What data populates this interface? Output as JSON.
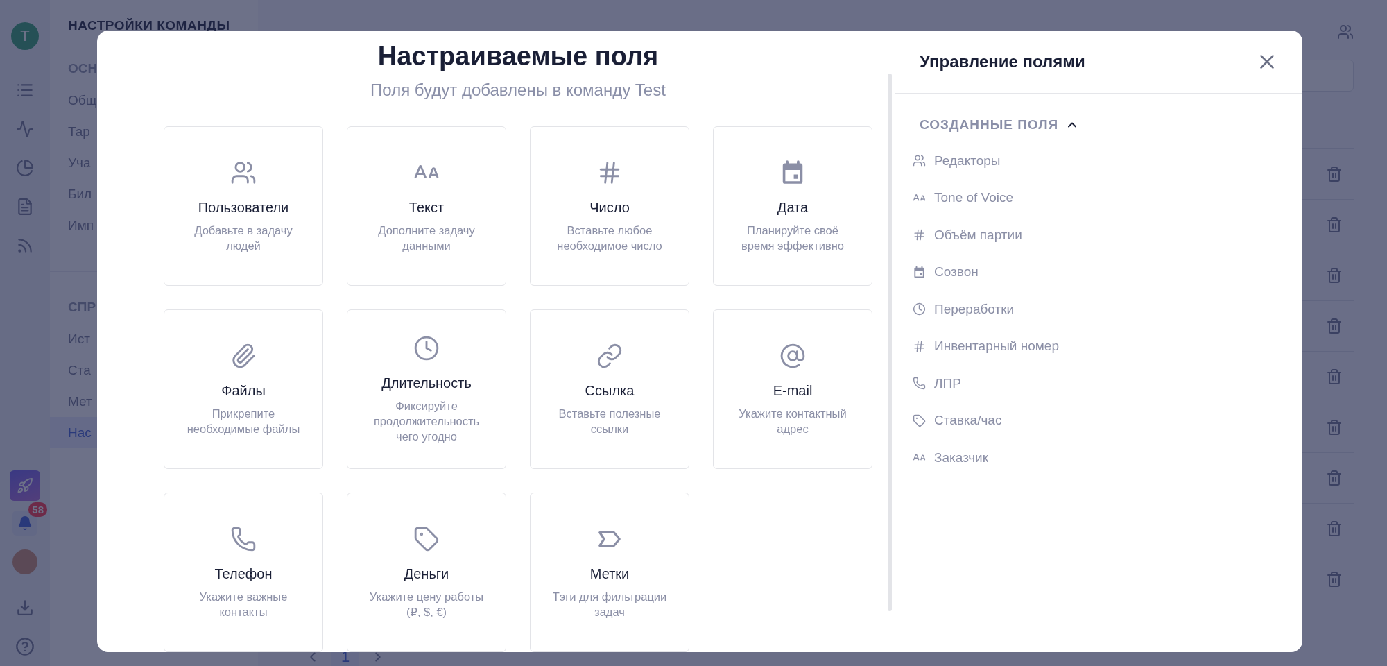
{
  "rail": {
    "team_initial": "T",
    "notifications_badge": "58"
  },
  "settings_nav": {
    "title": "НАСТРОЙКИ КОМАНДЫ",
    "sections": [
      {
        "label": "ОСН",
        "items": [
          {
            "label": "Общ",
            "selected": false
          },
          {
            "label": "Тар",
            "selected": false
          },
          {
            "label": "Уча",
            "selected": false
          },
          {
            "label": "Бил",
            "selected": false
          },
          {
            "label": "Имп",
            "selected": false
          }
        ]
      },
      {
        "label": "СПР",
        "items": [
          {
            "label": "Ист",
            "selected": false
          },
          {
            "label": "Ста",
            "selected": false
          },
          {
            "label": "Мет",
            "selected": false
          },
          {
            "label": "Нас",
            "selected": true
          }
        ]
      }
    ]
  },
  "pagination": {
    "current_page": "1"
  },
  "modal": {
    "title": "Настраиваемые поля",
    "subtitle": "Поля будут добавлены в команду Test",
    "field_types": [
      {
        "kind": "users",
        "title": "Пользователи",
        "description": "Добавьте в задачу людей"
      },
      {
        "kind": "text",
        "title": "Текст",
        "description": "Дополните задачу данными"
      },
      {
        "kind": "number",
        "title": "Число",
        "description": "Вставьте любое необходимое число"
      },
      {
        "kind": "date",
        "title": "Дата",
        "description": "Планируйте своё время эффективно"
      },
      {
        "kind": "files",
        "title": "Файлы",
        "description": "Прикрепите необходимые файлы"
      },
      {
        "kind": "duration",
        "title": "Длительность",
        "description": "Фиксируйте продолжительность чего угодно"
      },
      {
        "kind": "link",
        "title": "Ссылка",
        "description": "Вставьте полезные ссылки"
      },
      {
        "kind": "email",
        "title": "E-mail",
        "description": "Укажите контактный адрес"
      },
      {
        "kind": "phone",
        "title": "Телефон",
        "description": "Укажите важные контакты"
      },
      {
        "kind": "money",
        "title": "Деньги",
        "description": "Укажите цену работы (₽, $, €)"
      },
      {
        "kind": "tags",
        "title": "Метки",
        "description": "Тэги для фильтрации задач"
      }
    ],
    "panel": {
      "title": "Управление полями",
      "section": {
        "label": "СОЗДАННЫЕ ПОЛЯ",
        "expanded": true,
        "fields": [
          {
            "kind": "users",
            "label": "Редакторы"
          },
          {
            "kind": "text",
            "label": "Tone of Voice"
          },
          {
            "kind": "number",
            "label": "Объём партии"
          },
          {
            "kind": "date",
            "label": "Созвон"
          },
          {
            "kind": "duration",
            "label": "Переработки"
          },
          {
            "kind": "number",
            "label": "Инвентарный номер"
          },
          {
            "kind": "phone",
            "label": "ЛПР"
          },
          {
            "kind": "money",
            "label": "Ставка/час"
          },
          {
            "kind": "text",
            "label": "Заказчик"
          }
        ]
      }
    }
  }
}
